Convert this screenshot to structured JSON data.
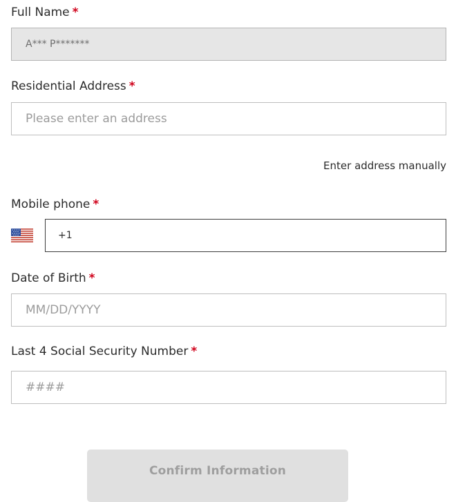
{
  "form": {
    "full_name": {
      "label": "Full Name",
      "required_mark": "*",
      "value": "A*** P*******"
    },
    "address": {
      "label": "Residential Address",
      "required_mark": "*",
      "placeholder": "Please enter an address",
      "manual_link": "Enter address manually"
    },
    "phone": {
      "label": "Mobile phone",
      "required_mark": "*",
      "country_flag": "us-flag-icon",
      "value": "+1"
    },
    "dob": {
      "label": "Date of Birth",
      "required_mark": "*",
      "placeholder": "MM/DD/YYYY"
    },
    "ssn": {
      "label": "Last 4 Social Security Number",
      "required_mark": "*",
      "placeholder": "####"
    },
    "submit_label": "Confirm Information"
  },
  "colors": {
    "required": "#d0021b",
    "disabled_bg": "#e6e6e6",
    "button_disabled_bg": "#e0e0e0",
    "button_disabled_text": "#9e9e9e"
  }
}
